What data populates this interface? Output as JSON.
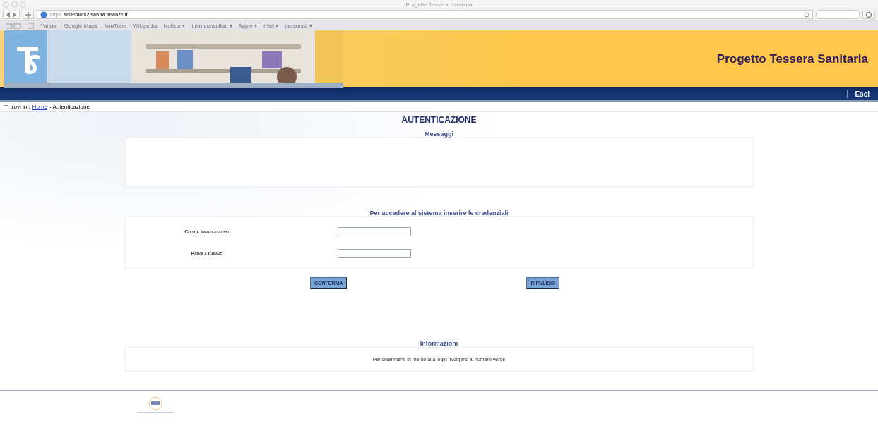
{
  "window": {
    "title": "Progetto Tessera Sanitaria"
  },
  "toolbar": {
    "url_scheme": "https",
    "url_host": "sistemats2.sanita.finanze.it"
  },
  "bookmarks": [
    "Yahoo!",
    "Google Maps",
    "YouTube",
    "Wikipedia",
    "Notizie ▾",
    "I più consultati ▾",
    "Apple ▾",
    "miei ▾",
    "personali ▾"
  ],
  "header": {
    "title": "Progetto Tessera Sanitaria",
    "exit": "Esci"
  },
  "breadcrumb": {
    "prefix": "Ti trovi in :",
    "link": "Home",
    "current": "- Autenticazione"
  },
  "page_title": "AUTENTICAZIONE",
  "messages": {
    "title": "Messaggi"
  },
  "credentials": {
    "title": "Per accedere al sistema inserire le credenziali",
    "fields": [
      {
        "label": "Codice Identificativo"
      },
      {
        "label": "Parola Chiave"
      }
    ]
  },
  "buttons": [
    "CONFERMA",
    "RIPULISCI"
  ],
  "info": {
    "title": "Informazioni",
    "text": "Per chiarimenti in merito alla login rivolgersi al numero verde"
  }
}
